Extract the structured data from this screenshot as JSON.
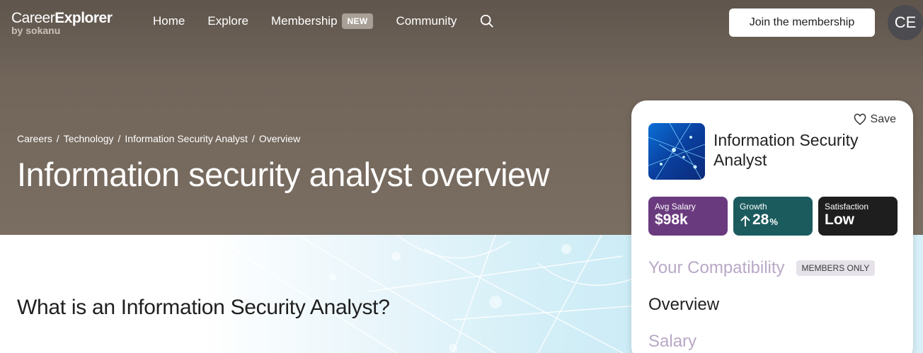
{
  "header": {
    "logo_main_light": "Career",
    "logo_main_bold": "Explorer",
    "logo_sub": "by sokanu",
    "nav": [
      {
        "label": "Home"
      },
      {
        "label": "Explore"
      },
      {
        "label": "Membership",
        "badge": "NEW"
      },
      {
        "label": "Community"
      }
    ],
    "search_icon": "search-icon",
    "join_label": "Join the membership",
    "avatar_initials": "CE"
  },
  "breadcrumb": [
    "Careers",
    "Technology",
    "Information Security Analyst",
    "Overview"
  ],
  "breadcrumb_separator": "/",
  "page_title": "Information security analyst overview",
  "section_heading": "What is an Information Security Analyst?",
  "card": {
    "save_label": "Save",
    "career_name": "Information Security Analyst",
    "stats": {
      "salary": {
        "label": "Avg Salary",
        "value": "$98k",
        "color": "#6a3a7e"
      },
      "growth": {
        "label": "Growth",
        "value": "28",
        "unit": "%",
        "icon": "arrow-up-icon",
        "color": "#1b5b5e"
      },
      "satisfaction": {
        "label": "Satisfaction",
        "value": "Low",
        "color": "#1e1e1e"
      }
    },
    "compatibility_label": "Your Compatibility",
    "members_badge": "MEMBERS ONLY",
    "nav_overview": "Overview",
    "nav_salary": "Salary"
  }
}
